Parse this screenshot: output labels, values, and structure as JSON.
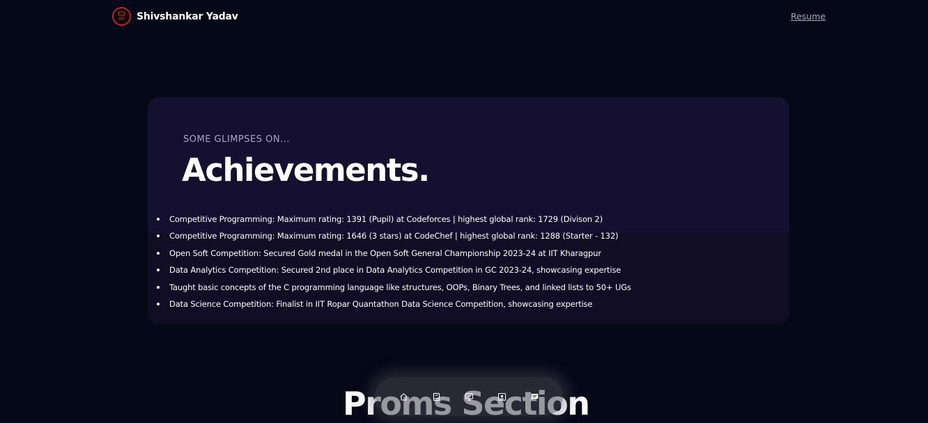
{
  "nav": {
    "brand_name": "Shivshankar Yadav",
    "resume_label": "Resume",
    "logo_icon": "avatar-logo-icon"
  },
  "section": {
    "subtitle": "SOME GLIMPSES ON...",
    "title": "Achievements.",
    "items": [
      "Competitive Programming: Maximum rating: 1391 (Pupil) at Codeforces | highest global rank: 1729 (Divison 2)",
      "Competitive Programming: Maximum rating: 1646 (3 stars) at CodeChef | highest global rank: 1288 (Starter - 132)",
      "Open Soft Competition: Secured Gold medal in the Open Soft General Championship 2023-24 at IIT Kharagpur",
      "Data Analytics Competition: Secured 2nd place in Data Analytics Competition in GC 2023-24, showcasing expertise",
      "Taught basic concepts of the C programming language like structures, OOPs, Binary Trees, and linked lists to 50+ UGs",
      "Data Science Competition: Finalist in IIT Ropar Quantathon Data Science Competition, showcasing expertise"
    ]
  },
  "next_section_title": "Proms Section",
  "dock": {
    "icons": [
      "home-icon",
      "book-icon",
      "presentation-icon",
      "contact-card-icon",
      "message-icon"
    ]
  },
  "colors": {
    "background": "#050816",
    "card": "#100d25",
    "card_top": "#151030",
    "secondary_text": "#aaa6c3",
    "logo_ring": "#b3262b"
  }
}
